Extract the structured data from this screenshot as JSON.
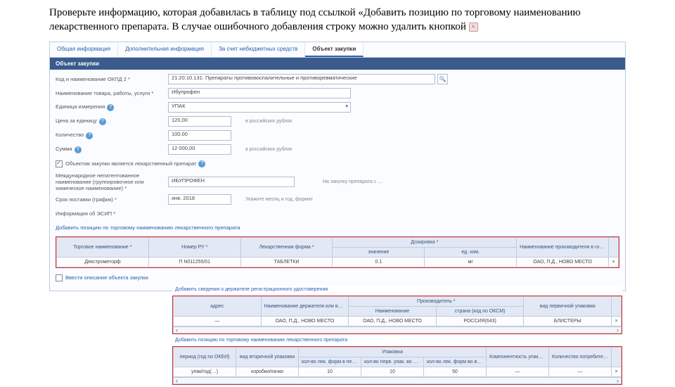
{
  "instruction": "Проверьте информацию, которая добавилась в таблицу под ссылкой «Добавить позицию по торговому наименованию лекарственного препарата. В случае ошибочного добавления строку можно удалить кнопкой",
  "delete_btn_glyph": "×",
  "tabs": {
    "t0": "Общая информация",
    "t1": "Дополнительная информация",
    "t2": "За счет небюджетных средств",
    "t3": "Объект закупки"
  },
  "section_title": "Объект закупки",
  "form": {
    "okpd_label": "Код и наименование ОКПД 2 *",
    "okpd_value": "21.20.10.131: Препараты противовоспалительные и противоревматические",
    "name_label": "Наименование товара, работы, услуги *",
    "name_value": "Ибупрофен",
    "unit_label": "Единица измерения",
    "unit_value": "УПАК",
    "price_label": "Цена за единицу",
    "price_value": "120,00",
    "price_note": "в российских рублях",
    "qty_label": "Количество",
    "qty_value": "100.00",
    "sum_label": "Сумма",
    "sum_value": "12 000,00",
    "sum_note": "в российских рублях",
    "is_drug_label": "Объектом закупки является лекарственный препарат",
    "mnn_label": "Международное непатентованное наименование (группировочное или химическое наименование) *",
    "mnn_value": "ИБУПРОФЕН",
    "mnn_note": "На закупку препарата с …",
    "deadline_label": "Срок поставки (график) *",
    "deadline_value": "янв. 2018",
    "deadline_note": "Укажите месяц и год, формат",
    "extra_label": "Информация об ЭСИП *",
    "add_link": "Добавить позицию по торговому наименованию лекарственного препарата"
  },
  "table1": {
    "h1": "Торговое наименование *",
    "h2": "Номер РУ *",
    "h3": "Лекарственная форма *",
    "h_grp": "Дозировка *",
    "h4a": "значение",
    "h4b": "ед. изм.",
    "h5": "Наименование производителя в государстве",
    "r1c1": "Декстрометорф",
    "r1c2": "П N011255/01",
    "r1c3": "ТАБЛЕТКИ",
    "r1c4": "0.1",
    "r1c5": "мг",
    "r1c6": "ОАО, П.Д., НОВО МЕСТО"
  },
  "table2_link": "Добавить сведения о держателе регистрационного удостоверения",
  "table2": {
    "h1": "адрес",
    "h_grp": "Производитель *",
    "h2": "Наименование держателя или владельца РУ",
    "h3": "Наименование",
    "h4": "страна (код по ОКСМ)",
    "h5": "вид первичной упаковки",
    "r1c1": "—",
    "r1c2": "ОАО, П.Д., НОВО МЕСТО",
    "r1c3": "ОАО, П.Д., НОВО МЕСТО",
    "r1c4": "РОССИЯ(643)",
    "r1c5": "БЛИСТЕРЫ"
  },
  "table3_link": "Добавить позицию по торговому наименованию лекарственного препарата",
  "table3": {
    "h1": "период (год по ОКЕИ)",
    "h2": "вид вторичной упаковки",
    "h_grp": "Упаковка",
    "h3a": "кол-во лек. форм в перв. упак.",
    "h3b": "кол-во перв. упак. во втор. упак.",
    "h3c": "кол-во лек. форм во втор. упак.",
    "h4": "Компонентность упаковки *",
    "h5": "Количество потребительских упаковок",
    "r1c1": "упак/год(…)",
    "r1c2": "коробки/пачки",
    "r1c3": "10",
    "r1c4": "10",
    "r1c5": "50",
    "r1c6": "—",
    "r1c7": "—"
  },
  "footer_check": "Ввести описание объекта закупки"
}
